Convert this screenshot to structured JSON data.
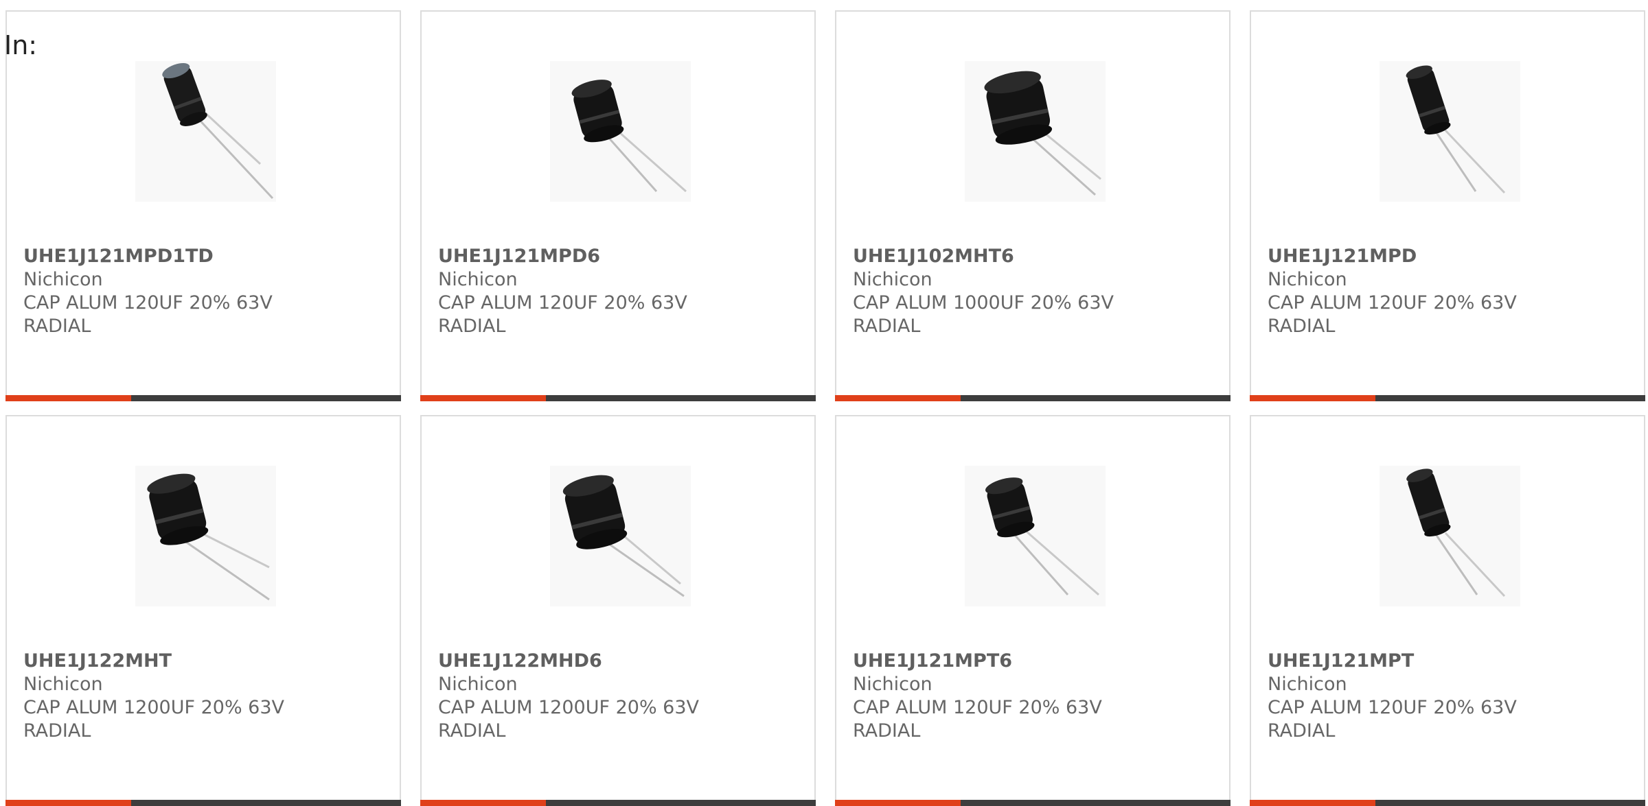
{
  "in_label": "In:",
  "colors": {
    "accent": "#e0401a",
    "bar": "#3d3d3d",
    "border": "#dcdcdc",
    "text": "#666666"
  },
  "cards": [
    {
      "part_number": "UHE1J121MPD1TD",
      "manufacturer": "Nichicon",
      "description": "CAP ALUM 120UF 20% 63V RADIAL",
      "image_icon": "radial-capacitor-icon"
    },
    {
      "part_number": "UHE1J121MPD6",
      "manufacturer": "Nichicon",
      "description": "CAP ALUM 120UF 20% 63V RADIAL",
      "image_icon": "radial-capacitor-icon"
    },
    {
      "part_number": "UHE1J102MHT6",
      "manufacturer": "Nichicon",
      "description": "CAP ALUM 1000UF 20% 63V RADIAL",
      "image_icon": "radial-capacitor-icon"
    },
    {
      "part_number": "UHE1J121MPD",
      "manufacturer": "Nichicon",
      "description": "CAP ALUM 120UF 20% 63V RADIAL",
      "image_icon": "radial-capacitor-icon"
    },
    {
      "part_number": "UHE1J122MHT",
      "manufacturer": "Nichicon",
      "description": "CAP ALUM 1200UF 20% 63V RADIAL",
      "image_icon": "radial-capacitor-icon"
    },
    {
      "part_number": "UHE1J122MHD6",
      "manufacturer": "Nichicon",
      "description": "CAP ALUM 1200UF 20% 63V RADIAL",
      "image_icon": "radial-capacitor-icon"
    },
    {
      "part_number": "UHE1J121MPT6",
      "manufacturer": "Nichicon",
      "description": "CAP ALUM 120UF 20% 63V RADIAL",
      "image_icon": "radial-capacitor-icon"
    },
    {
      "part_number": "UHE1J121MPT",
      "manufacturer": "Nichicon",
      "description": "CAP ALUM 120UF 20% 63V RADIAL",
      "image_icon": "radial-capacitor-icon"
    }
  ]
}
